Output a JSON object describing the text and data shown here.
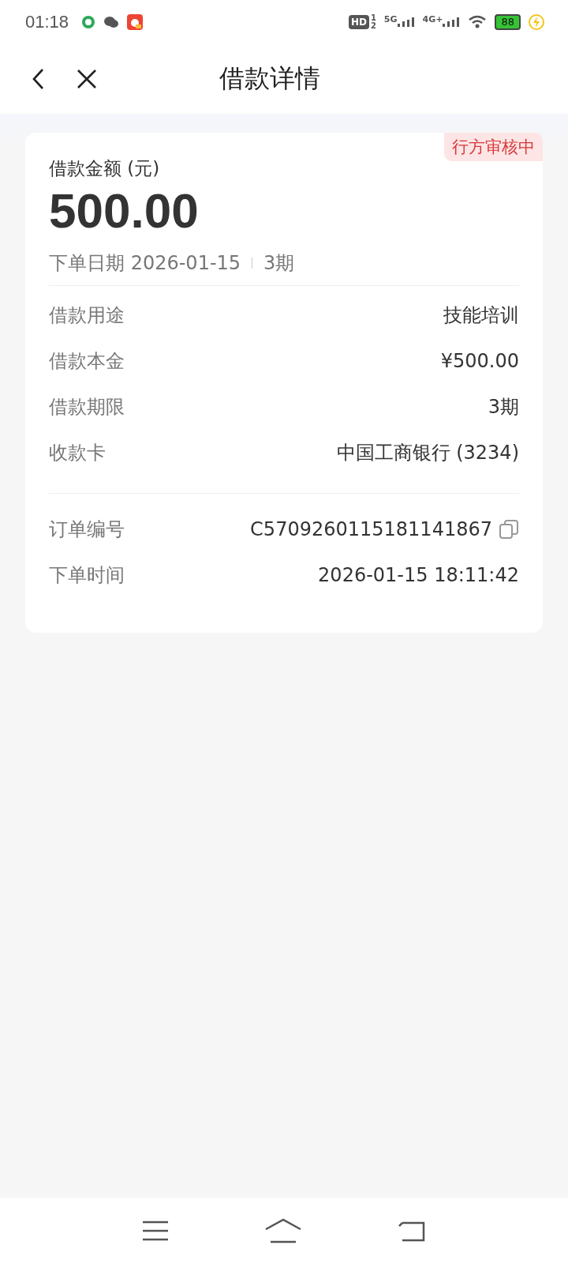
{
  "status_bar": {
    "time": "01:18",
    "hd": "HD",
    "hd_slots": [
      "1",
      "2"
    ],
    "signals": [
      {
        "label": "5G"
      },
      {
        "label": "4G+"
      }
    ],
    "battery": "88",
    "charging": true
  },
  "header": {
    "title": "借款详情"
  },
  "card": {
    "badge": "行方审核中",
    "amount_label": "借款金额 (元)",
    "amount": "500.00",
    "date": "下单日期 2026-01-15",
    "periods": "3期",
    "rows": [
      {
        "label": "借款用途",
        "value": "技能培训"
      },
      {
        "label": "借款本金",
        "value": "¥500.00"
      },
      {
        "label": "借款期限",
        "value": "3期"
      },
      {
        "label": "收款卡",
        "value": "中国工商银行 (3234)"
      }
    ],
    "order_rows": [
      {
        "label": "订单编号",
        "value": "C5709260115181141867",
        "copyable": true
      },
      {
        "label": "下单时间",
        "value": "2026-01-15 18:11:42",
        "copyable": false
      }
    ]
  }
}
